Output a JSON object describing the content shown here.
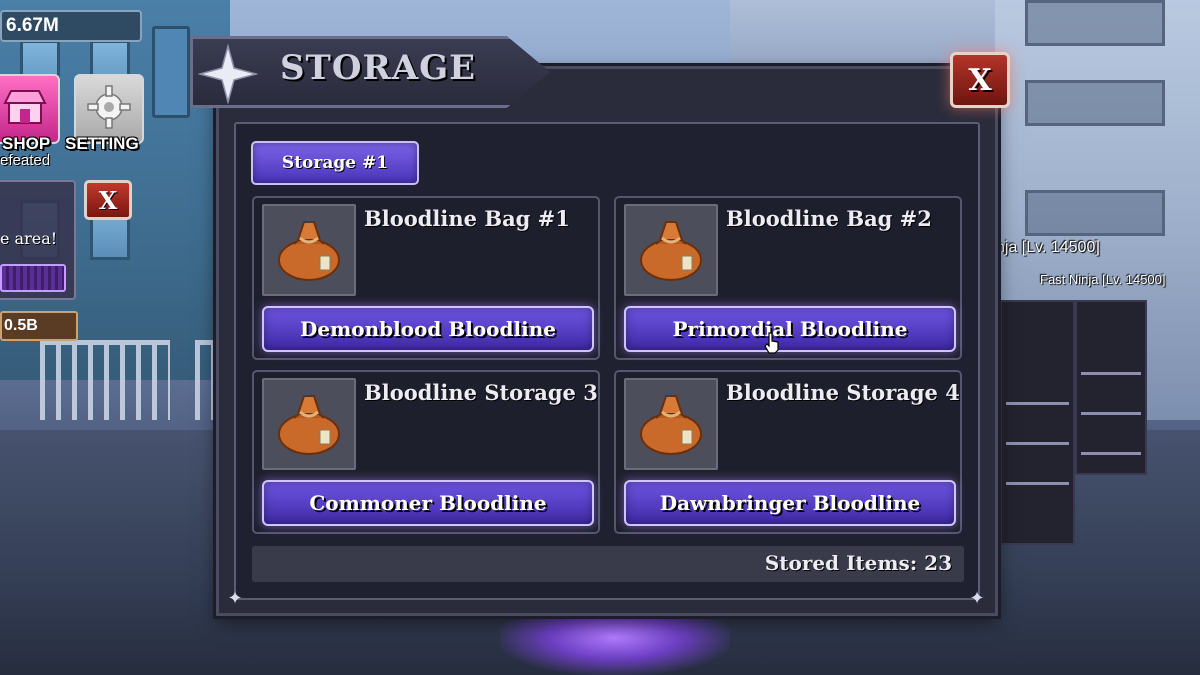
{
  "hud": {
    "money": "6.67M",
    "shop_label": "SHOP",
    "setting_label": "SETTING",
    "defeated_text": "efeated",
    "quest_text": "e area!",
    "quest_close": "X",
    "reward": "0.5B"
  },
  "storage": {
    "title": "STORAGE",
    "close_label": "X",
    "tab_label": "Storage #1",
    "slots": [
      {
        "title": "Bloodline Bag #1",
        "bloodline": "Demonblood Bloodline",
        "icon": "loot-bag-icon"
      },
      {
        "title": "Bloodline Bag #2",
        "bloodline": "Primordial Bloodline",
        "icon": "loot-bag-icon"
      },
      {
        "title": "Bloodline Storage 3",
        "bloodline": "Commoner Bloodline",
        "icon": "loot-bag-icon"
      },
      {
        "title": "Bloodline Storage 4",
        "bloodline": "Dawnbringer Bloodline",
        "icon": "loot-bag-icon"
      }
    ],
    "stored_items": "Stored Items: 23"
  },
  "world": {
    "npc_label_1": "nja [Lv. 14500]",
    "npc_label_2": "Fast Ninja [Lv. 14500]"
  },
  "colors": {
    "panel_bg": "#2a2c3b",
    "accent_purple": "#6f55e3",
    "close_red": "#b2352a"
  }
}
